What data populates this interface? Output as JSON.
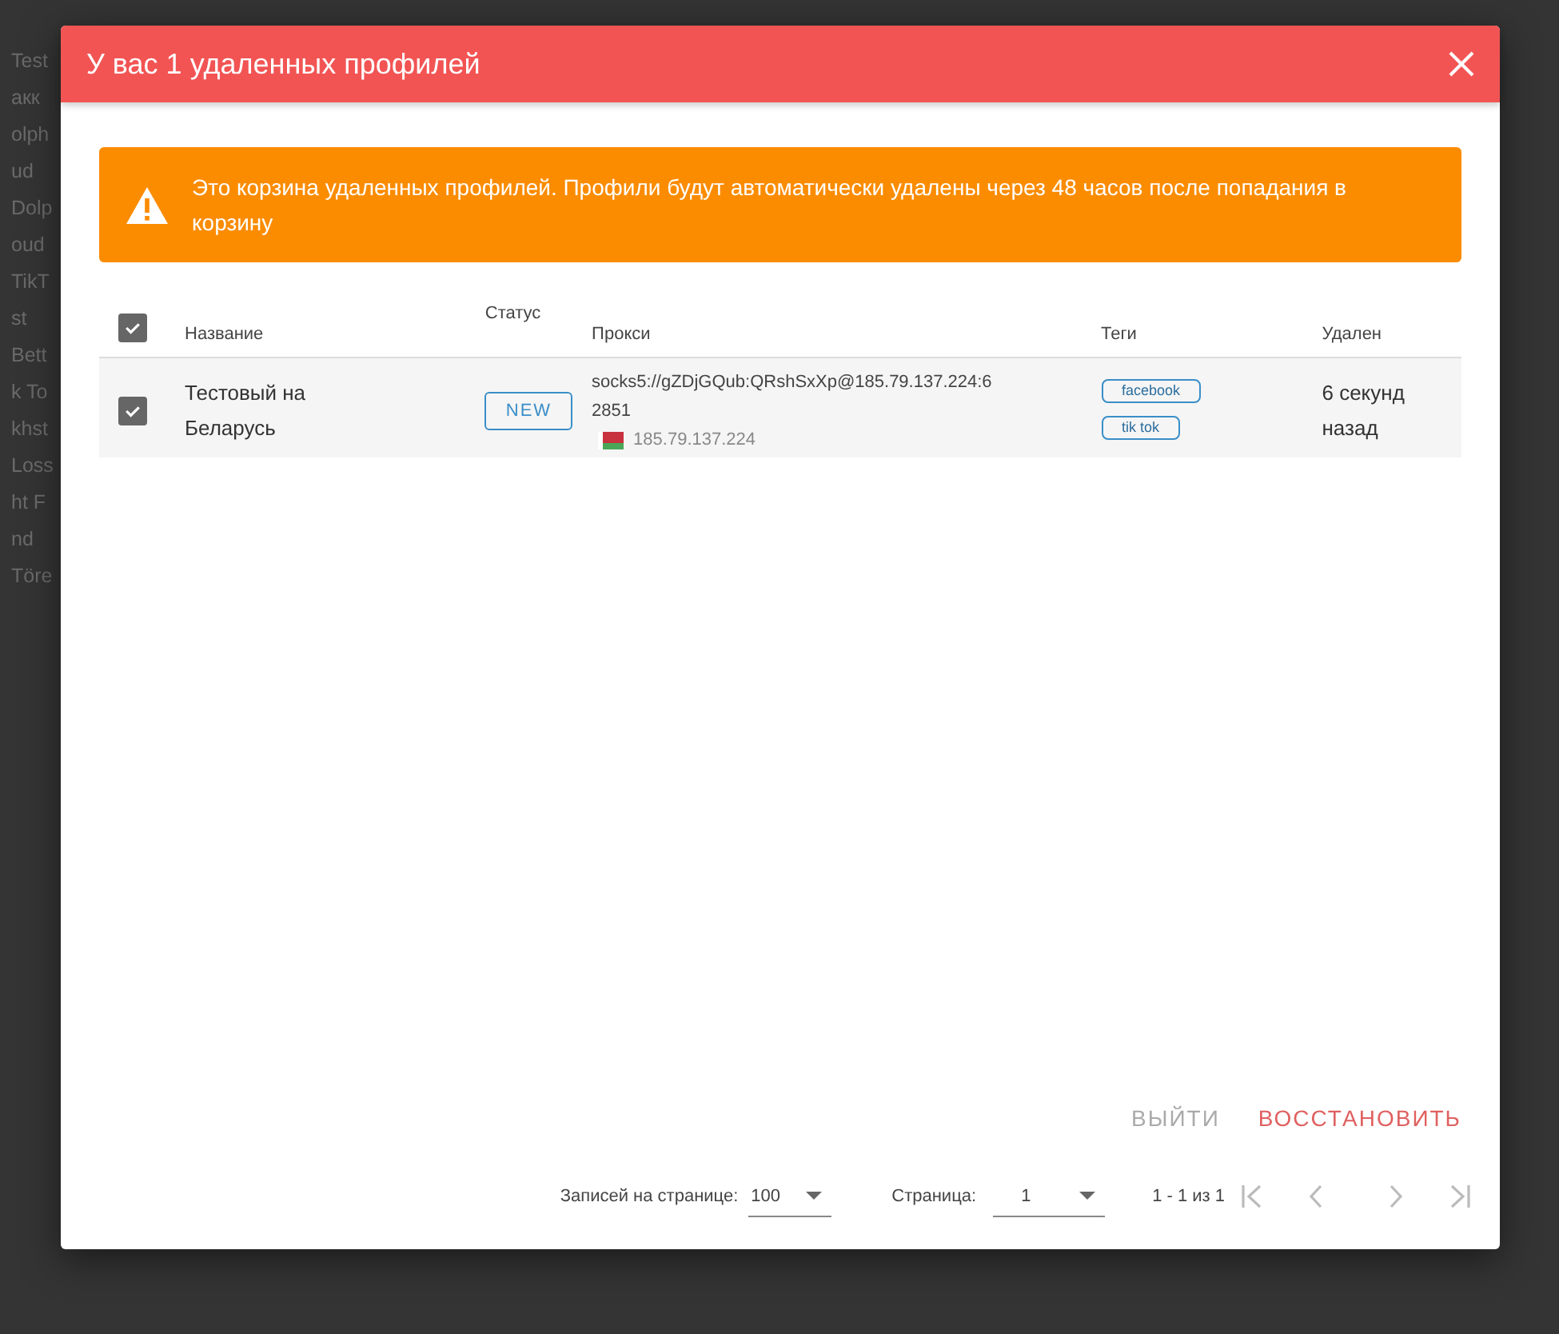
{
  "background": {
    "row_texts": [
      "Test",
      "акк",
      "olph",
      "ud",
      "Dolp",
      "oud",
      "TikT",
      "st",
      "Bett",
      "k To",
      "khst",
      "Loss",
      "ht F",
      "nd",
      "Töre"
    ]
  },
  "dialog": {
    "title": "У вас 1 удаленных профилей",
    "warning": "Это корзина удаленных профилей. Профили будут автоматически удалены через 48 часов после попадания в корзину",
    "table": {
      "select_all_checked": true,
      "columns": [
        "Название",
        "Статус",
        "Прокси",
        "Теги",
        "Удален"
      ],
      "rows": [
        {
          "checked": true,
          "name": "Тестовый на Беларусь",
          "status": "NEW",
          "proxy": "socks5://gZDjGQub:QRshSxXp@185.79.137.224:62851",
          "ip": "185.79.137.224",
          "tags": [
            "facebook",
            "tik tok"
          ],
          "deleted": "6 секунд назад"
        }
      ]
    },
    "buttons": [
      {
        "label": "ВЫЙТИ",
        "kind": "secondary"
      },
      {
        "label": "ВОССТАНОВИТЬ",
        "kind": "primary"
      }
    ],
    "pagination": {
      "per_page_label": "Записей на странице:",
      "per_page": "100",
      "page_label": "Страница:",
      "page": "1",
      "range": "1 - 1 из 1"
    }
  }
}
